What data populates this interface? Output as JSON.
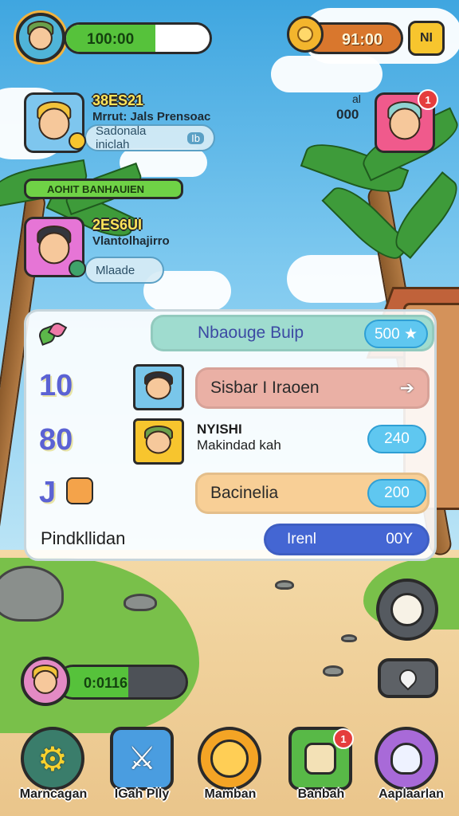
{
  "hud": {
    "xp_text": "100:00",
    "xp_progress": 0.62,
    "coins_text": "91:00",
    "menu_label": "NI"
  },
  "friends": [
    {
      "score": "38ES21",
      "name": "Mrrut: Jals Prensoac",
      "status": "Sadonala iniclah",
      "status_extra": "Ib"
    },
    {
      "banner": "AOHIT BANHAUIEN"
    },
    {
      "score": "2ES6UI",
      "name": "Vlantolhajirro",
      "status": "Mlaade"
    }
  ],
  "right_friend": {
    "label_top": "al",
    "label_bottom": "000",
    "badge": "1"
  },
  "panel": {
    "title": "Nbaouge Buip",
    "title_value": "500 ★",
    "rows": [
      {
        "num": "10",
        "label": "Sisbar I Iraoen",
        "arrow": "➔"
      },
      {
        "num": "80",
        "name": "NYISHI",
        "sub": "Makindad kah",
        "value": "240"
      },
      {
        "num": "J",
        "label": "Bacinelia",
        "value": "200"
      }
    ],
    "footer_label": "Pindkllidan",
    "footer_button": "Irenl",
    "footer_value": "00Y"
  },
  "bottom_bar": {
    "xp_text": "0:0116",
    "xp_progress": 0.55
  },
  "nav": [
    {
      "label": "Marncagan",
      "icon": "gear-icon"
    },
    {
      "label": "IGah Plly",
      "icon": "sword-icon"
    },
    {
      "label": "Mamban",
      "icon": "coin-icon"
    },
    {
      "label": "Banbah",
      "icon": "shop-icon",
      "badge": "1"
    },
    {
      "label": "Aaplaarlan",
      "icon": "creature-icon"
    }
  ],
  "colors": {
    "xp_green": "#56c23b",
    "panel_accent": "#5b62d4",
    "value_blue": "#5fc7f0"
  }
}
